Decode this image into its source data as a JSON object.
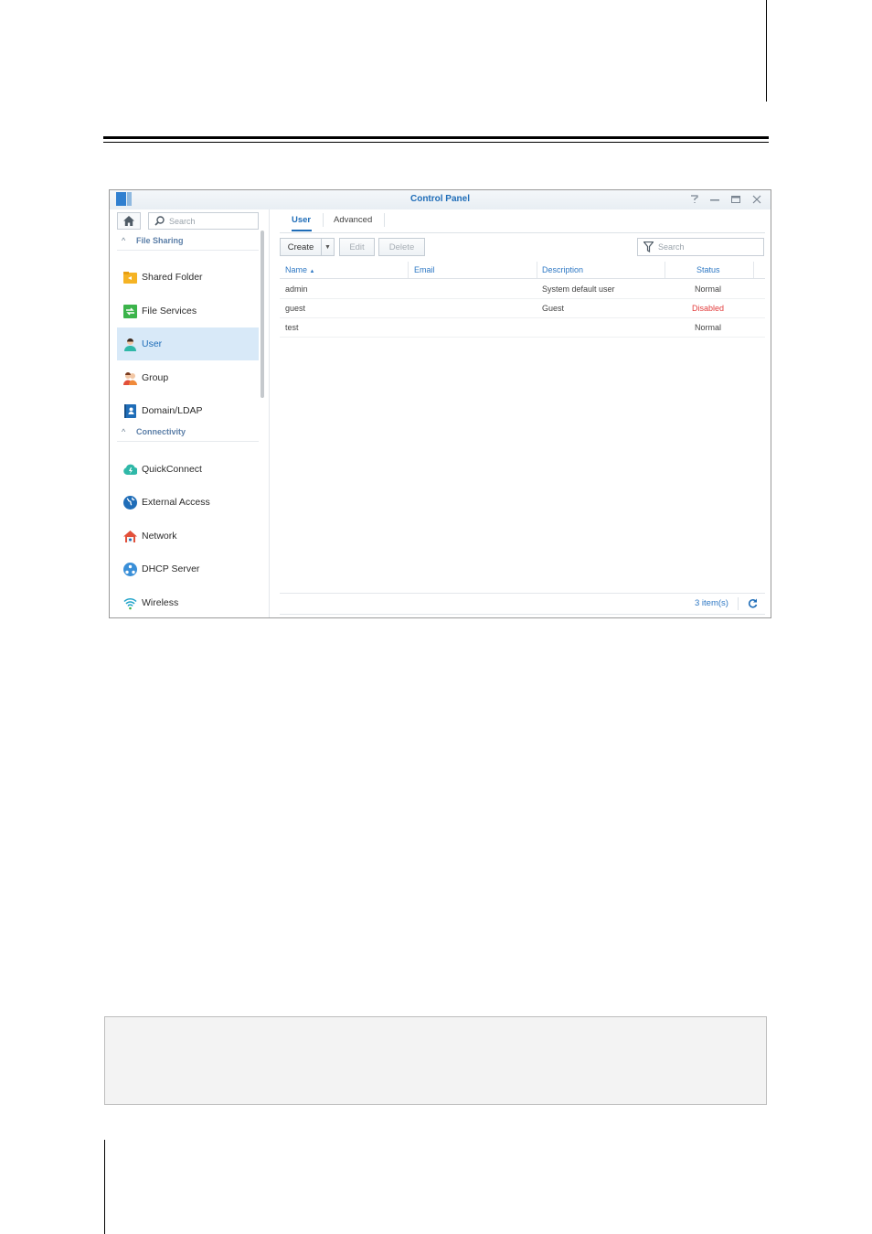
{
  "window": {
    "title": "Control Panel",
    "controls": [
      "help-icon",
      "minimize-icon",
      "maximize-icon",
      "close-icon"
    ]
  },
  "sidebar": {
    "search_placeholder": "Search",
    "sections": [
      {
        "label": "File Sharing",
        "items": [
          {
            "label": "Shared Folder",
            "icon": "shared-folder-icon"
          },
          {
            "label": "File Services",
            "icon": "file-services-icon"
          },
          {
            "label": "User",
            "icon": "user-icon",
            "active": true
          },
          {
            "label": "Group",
            "icon": "group-icon"
          },
          {
            "label": "Domain/LDAP",
            "icon": "domain-ldap-icon"
          }
        ]
      },
      {
        "label": "Connectivity",
        "items": [
          {
            "label": "QuickConnect",
            "icon": "quickconnect-icon"
          },
          {
            "label": "External Access",
            "icon": "external-access-icon"
          },
          {
            "label": "Network",
            "icon": "network-icon"
          },
          {
            "label": "DHCP Server",
            "icon": "dhcp-server-icon"
          },
          {
            "label": "Wireless",
            "icon": "wireless-icon"
          }
        ]
      }
    ]
  },
  "main": {
    "tabs": [
      {
        "label": "User",
        "active": true
      },
      {
        "label": "Advanced"
      }
    ],
    "toolbar": {
      "create_label": "Create",
      "edit_label": "Edit",
      "delete_label": "Delete",
      "search_placeholder": "Search"
    },
    "table": {
      "columns": [
        "Name",
        "Email",
        "Description",
        "Status"
      ],
      "sort_indicator": "▲",
      "rows": [
        {
          "name": "admin",
          "email": "",
          "description": "System default user",
          "status": "Normal"
        },
        {
          "name": "guest",
          "email": "",
          "description": "Guest",
          "status": "Disabled"
        },
        {
          "name": "test",
          "email": "",
          "description": "",
          "status": "Normal"
        }
      ]
    },
    "footer": {
      "count": "3 item(s)"
    }
  },
  "colors": {
    "accent": "#1f6db8",
    "active_row": "#d8e9f8",
    "disabled_status": "#e23c3c"
  }
}
